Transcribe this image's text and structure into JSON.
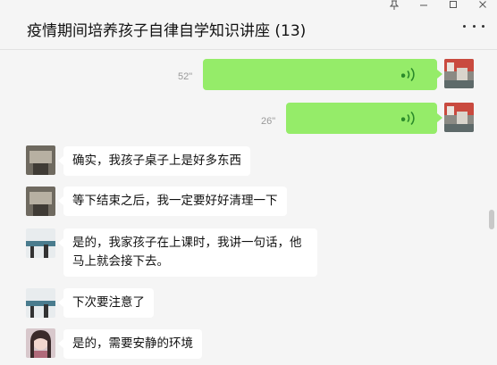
{
  "window": {
    "title": "疫情期间培养孩子自律自学知识讲座 (13)",
    "controls": [
      "pin",
      "minimize",
      "maximize",
      "close"
    ]
  },
  "messages": [
    {
      "side": "right",
      "type": "voice",
      "duration": "52\""
    },
    {
      "side": "right",
      "type": "voice",
      "duration": "26\""
    },
    {
      "side": "left",
      "type": "text",
      "text": "确实，我孩子桌子上是好多东西"
    },
    {
      "side": "left",
      "type": "text",
      "text": "等下结束之后，我一定要好好清理一下"
    },
    {
      "side": "left",
      "type": "text",
      "text": "是的，我家孩子在上课时，我讲一句话，他马上就会接下去。"
    },
    {
      "side": "left",
      "type": "text",
      "text": "下次要注意了"
    },
    {
      "side": "left",
      "type": "text",
      "text": "是的，需要安静的环境"
    }
  ],
  "colors": {
    "sent_bubble": "#95ec69",
    "received_bubble": "#ffffff",
    "background": "#f5f5f5"
  },
  "icons": [
    "pin-icon",
    "minimize-icon",
    "maximize-icon",
    "close-icon",
    "more-icon",
    "voice-wave-icon"
  ]
}
